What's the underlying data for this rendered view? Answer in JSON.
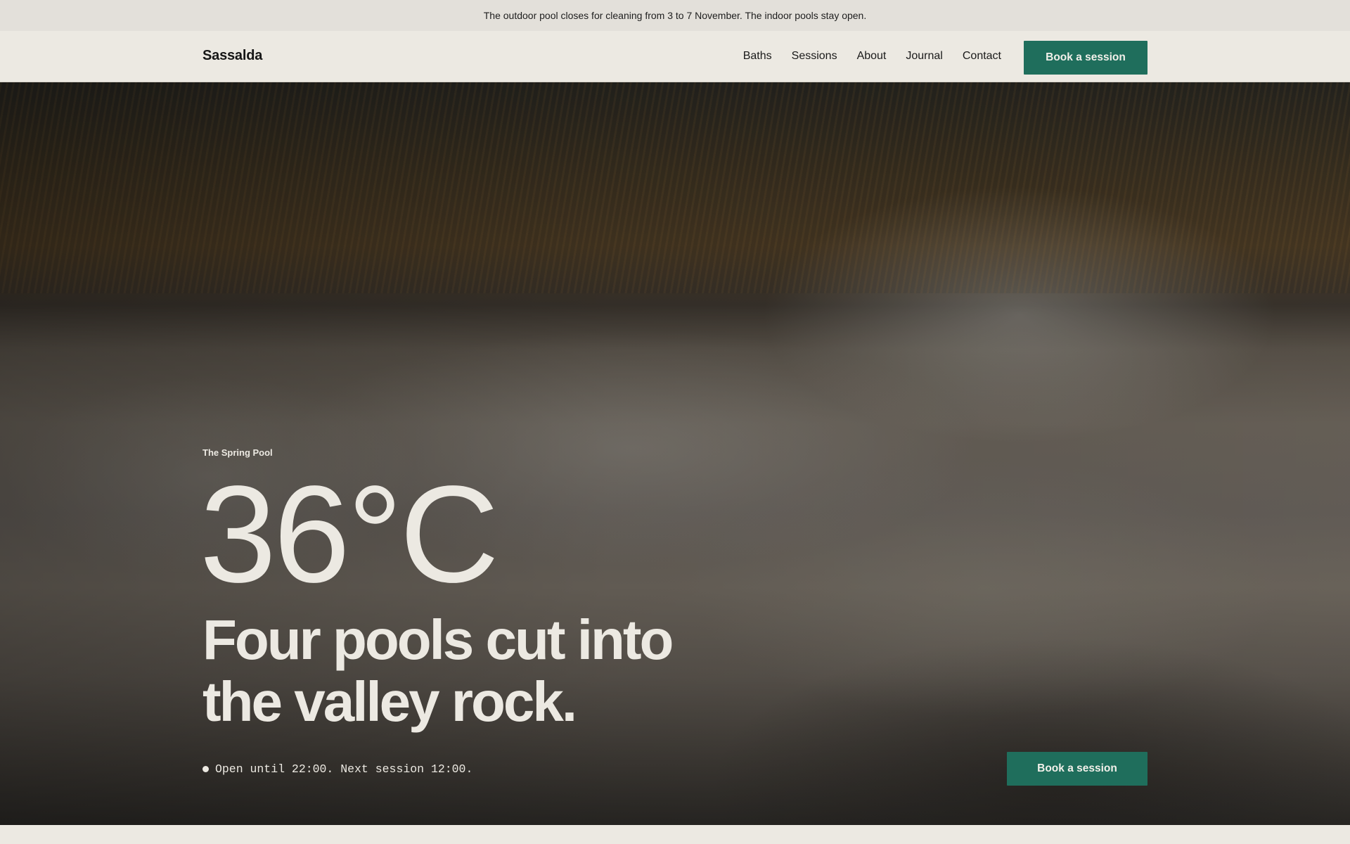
{
  "announcement": "The outdoor pool closes for cleaning from 3 to 7 November. The indoor pools stay open.",
  "header": {
    "brand": "Sassalda",
    "nav": [
      "Baths",
      "Sessions",
      "About",
      "Journal",
      "Contact"
    ],
    "cta": "Book a session"
  },
  "hero": {
    "eyebrow": "The Spring Pool",
    "temperature": "36°C",
    "headline_line1": "Four pools cut into",
    "headline_line2": "the valley rock.",
    "status": "Open until 22:00. Next session 12:00.",
    "cta": "Book a session"
  },
  "colors": {
    "accent": "#1f6e5c",
    "page_background": "#ece9e2",
    "announcement_background": "#e3e0da"
  }
}
